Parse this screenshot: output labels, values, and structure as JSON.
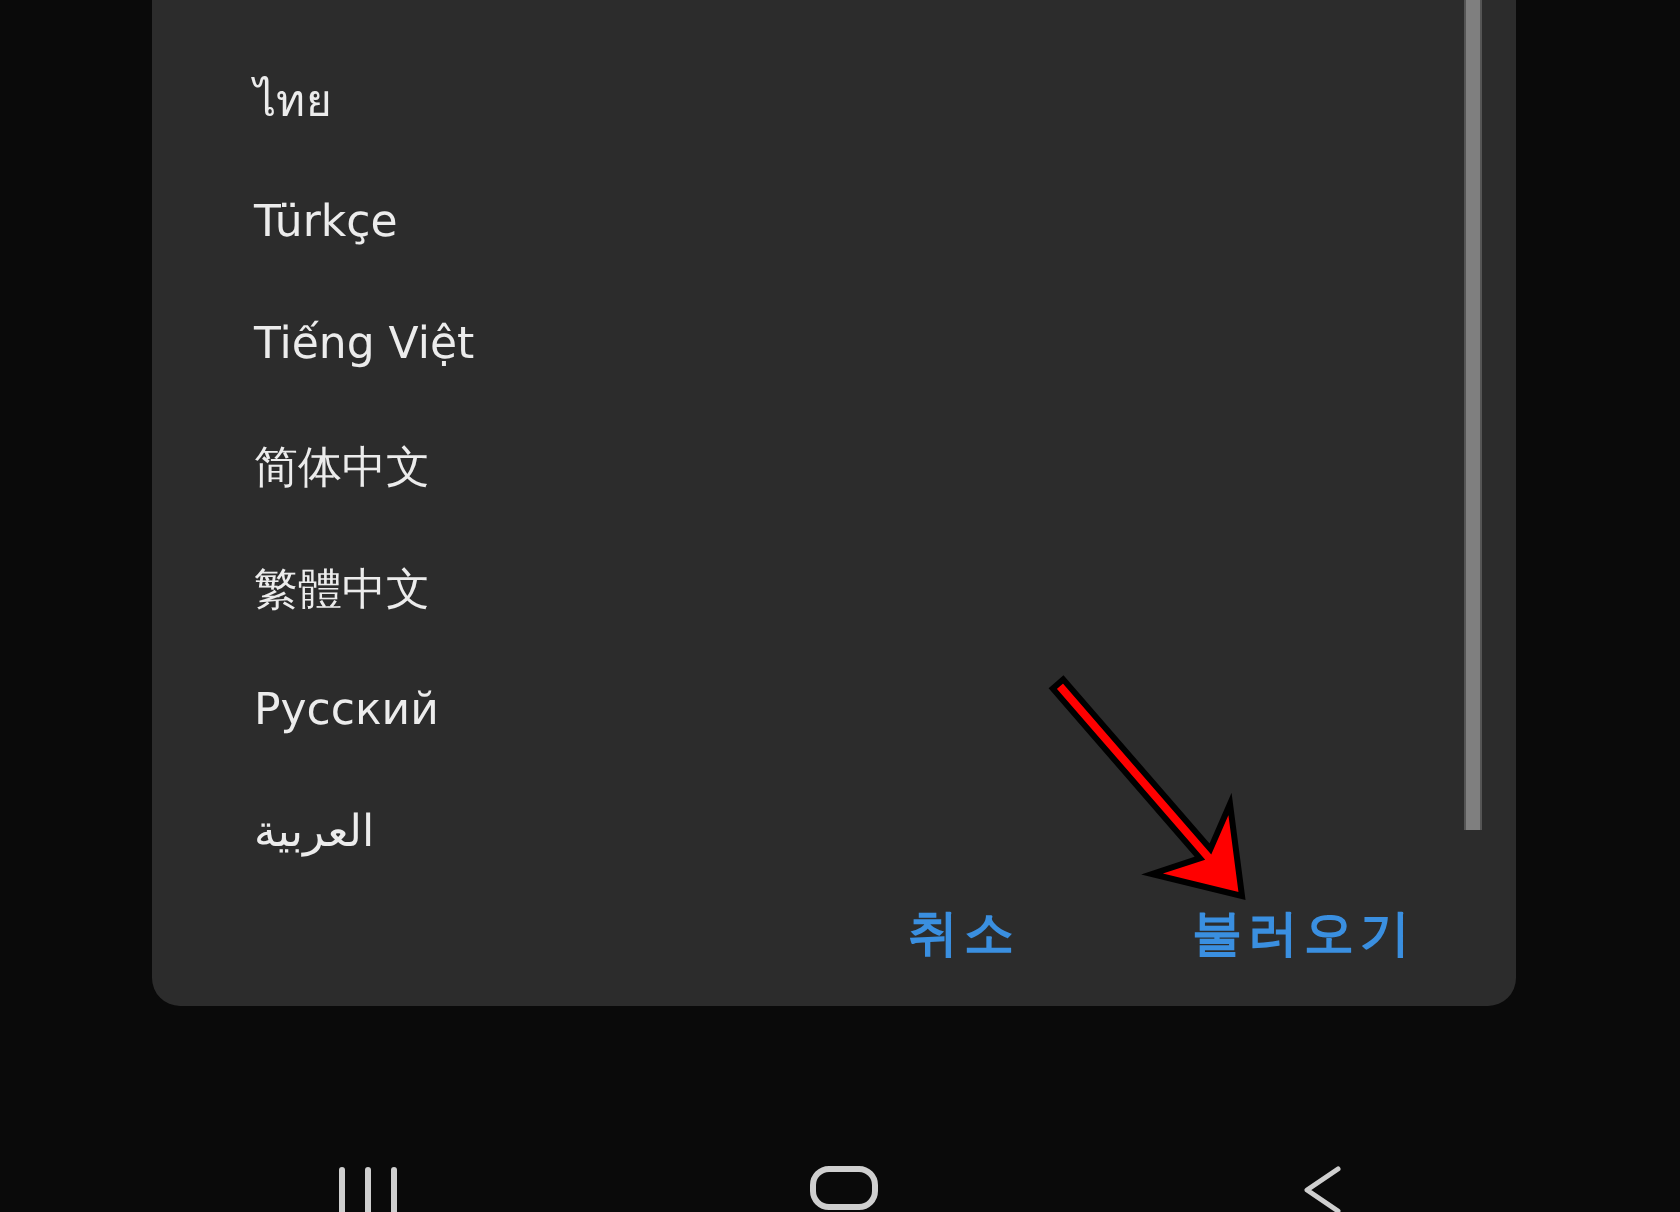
{
  "dialog": {
    "languages": [
      "ไทย",
      "Türkçe",
      "Tiếng Việt",
      "简体中文",
      "繁體中文",
      "Русский",
      "العربية"
    ],
    "buttons": [
      "취소",
      "불러오기"
    ]
  }
}
